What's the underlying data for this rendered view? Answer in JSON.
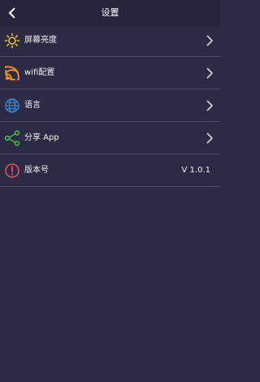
{
  "header": {
    "title": "设置",
    "back_icon": "chevron-left-icon"
  },
  "settings": [
    {
      "id": "brightness",
      "icon": "sun-icon",
      "label": "屏幕亮度",
      "color": "#e8c53a"
    },
    {
      "id": "wifi",
      "icon": "wifi-icon",
      "label": "wifi配置",
      "color": "#f08a1c"
    },
    {
      "id": "language",
      "icon": "globe-icon",
      "label": "语言",
      "color": "#2f86d6"
    },
    {
      "id": "share",
      "icon": "share-icon",
      "label": "分享 App",
      "color": "#3fbf3f"
    },
    {
      "id": "version",
      "icon": "info-icon",
      "label": "版本号",
      "value": "V 1.0.1",
      "color": "#e05555"
    }
  ]
}
